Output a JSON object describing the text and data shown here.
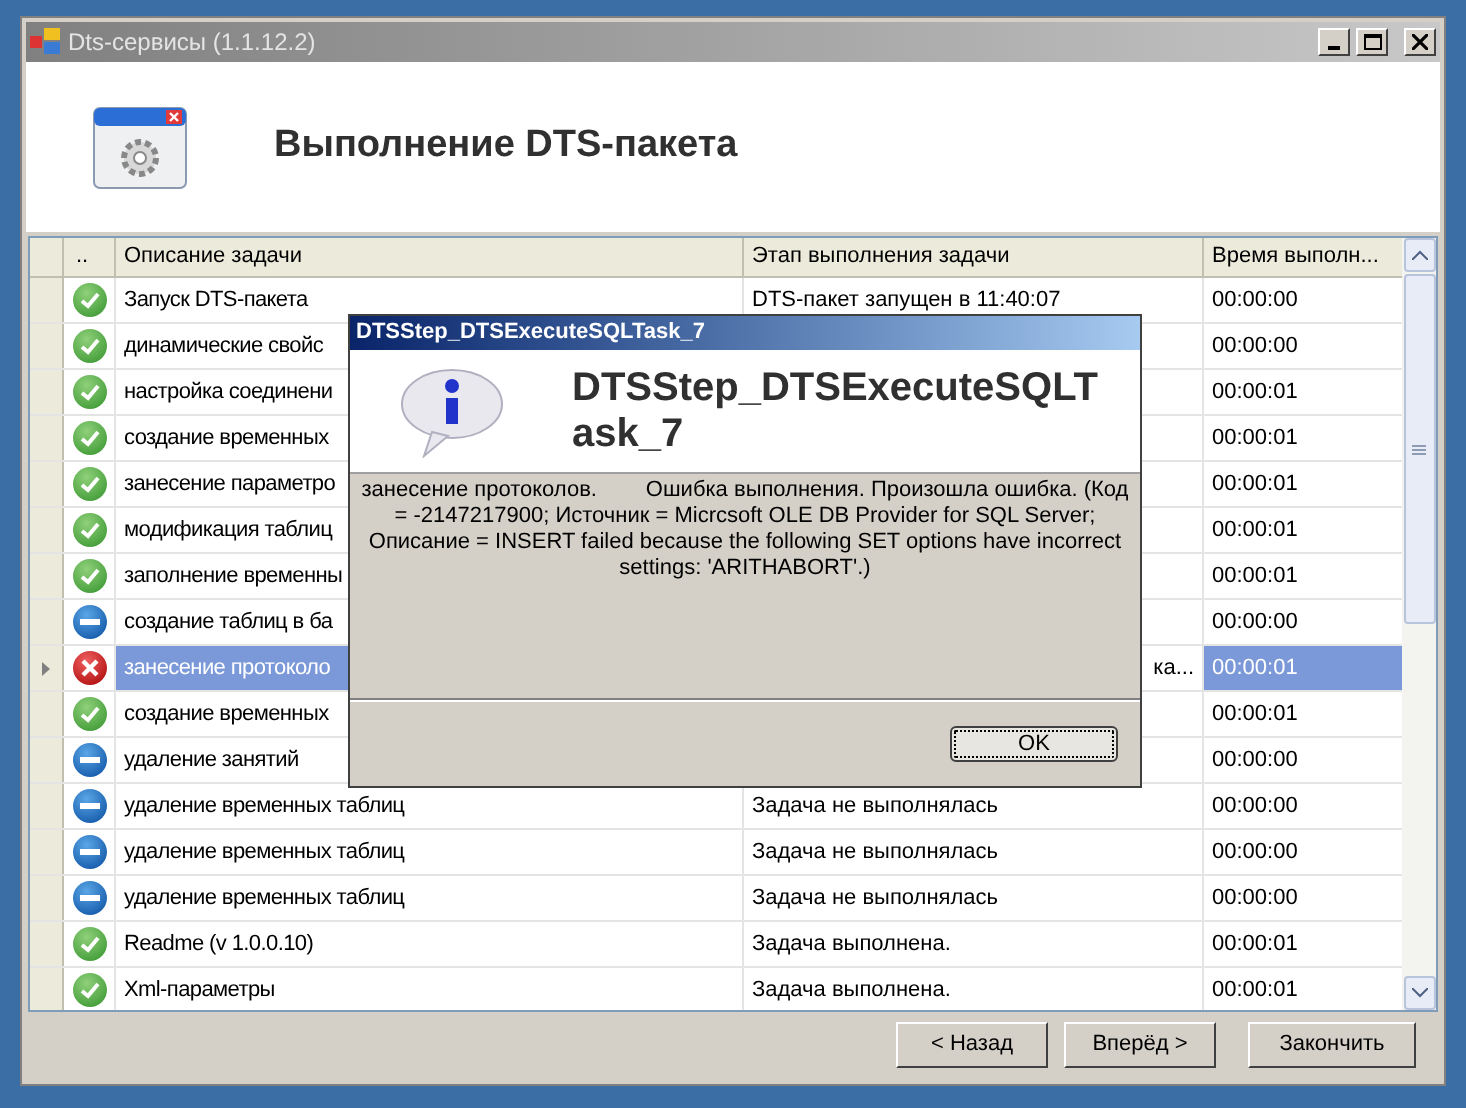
{
  "window": {
    "title": "Dts-сервисы (1.1.12.2)"
  },
  "header": {
    "title": "Выполнение DTS-пакета"
  },
  "table": {
    "columns": [
      "..",
      "Описание задачи",
      "Этап выполнения задачи",
      "Время выполн..."
    ],
    "rows": [
      {
        "kind": "ok",
        "selected": false,
        "description": "Запуск DTS-пакета",
        "stage": "DTS-пакет запущен в 11:40:07",
        "time": "00:00:00"
      },
      {
        "kind": "ok",
        "selected": false,
        "description": "динамические свойс",
        "time": "00:00:00"
      },
      {
        "kind": "ok",
        "selected": false,
        "description": "настройка соединени",
        "time": "00:00:01"
      },
      {
        "kind": "ok",
        "selected": false,
        "description": "создание временных",
        "time": "00:00:01"
      },
      {
        "kind": "ok",
        "selected": false,
        "description": "занесение параметро",
        "time": "00:00:01"
      },
      {
        "kind": "ok",
        "selected": false,
        "description": "модификация таблиц",
        "time": "00:00:01"
      },
      {
        "kind": "ok",
        "selected": false,
        "description": "заполнение временны",
        "time": "00:00:01"
      },
      {
        "kind": "skipped",
        "selected": false,
        "description": "создание таблиц в ба",
        "time": "00:00:00"
      },
      {
        "kind": "error",
        "selected": true,
        "description": "занесение протоколо",
        "stage": "ка...",
        "time": "00:00:01"
      },
      {
        "kind": "ok",
        "selected": false,
        "description": "создание временных",
        "time": "00:00:01"
      },
      {
        "kind": "skipped",
        "selected": false,
        "description": "удаление занятий",
        "time": "00:00:00"
      },
      {
        "kind": "skipped",
        "selected": false,
        "description": "удаление временных таблиц",
        "stage": "Задача не выполнялась",
        "time": "00:00:00"
      },
      {
        "kind": "skipped",
        "selected": false,
        "description": "удаление временных таблиц",
        "stage": "Задача не выполнялась",
        "time": "00:00:00"
      },
      {
        "kind": "skipped",
        "selected": false,
        "description": "удаление временных таблиц",
        "stage": "Задача не выполнялась",
        "time": "00:00:00"
      },
      {
        "kind": "ok",
        "selected": false,
        "description": "Readme (v 1.0.0.10)",
        "stage": "Задача выполнена.",
        "time": "00:00:01"
      },
      {
        "kind": "ok",
        "selected": false,
        "description": "Xml-параметры",
        "stage": "Задача выполнена.",
        "time": "00:00:01"
      }
    ]
  },
  "buttons": [
    "< Назад",
    "Вперёд >",
    "Закончить"
  ],
  "dialog": {
    "title": "DTSStep_DTSExecuteSQLTask_7",
    "heading": "DTSStep_DTSExecuteSQLTask_7",
    "message": "занесение протоколов.        Ошибка выполнения. Произошла ошибка. (Код = -2147217900; Источник = Micrcsoft OLE DB Provider for SQL Server; Описание = INSERT failed because the following SET options have incorrect settings: 'ARITHABORT'.)",
    "button": "OK"
  }
}
